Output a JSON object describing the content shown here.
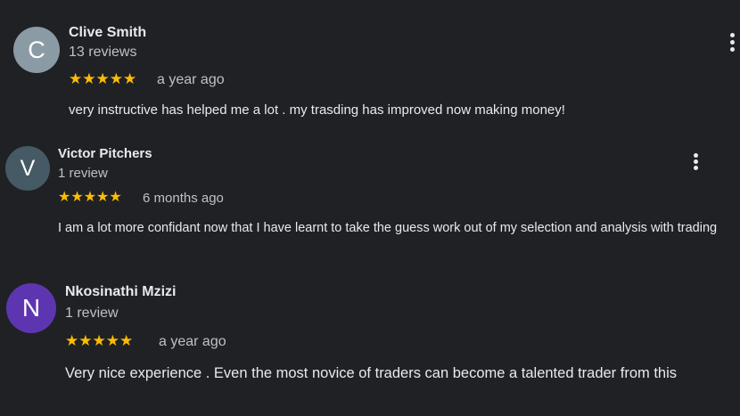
{
  "reviews": [
    {
      "avatar_letter": "C",
      "avatar_color": "#8a9ba6",
      "name": "Clive Smith",
      "reviews_count": "13 reviews",
      "rating": 5,
      "stars": "★★★★★",
      "date": "a year ago",
      "text": "very instructive has helped me a lot . my trasding has improved now making money!",
      "menu_icon": "more-vert-icon"
    },
    {
      "avatar_letter": "V",
      "avatar_color": "#455a64",
      "name": "Victor Pitchers",
      "reviews_count": "1 review",
      "rating": 5,
      "stars": "★★★★★",
      "date": "6 months ago",
      "text": "I am a lot more confidant now that I have learnt to take the guess work out of my selection and analysis with trading",
      "menu_icon": "more-vert-icon"
    },
    {
      "avatar_letter": "N",
      "avatar_color": "#5e35b1",
      "name": "Nkosinathi Mzizi",
      "reviews_count": "1 review",
      "rating": 5,
      "stars": "★★★★★",
      "date": "a year ago",
      "text": "Very nice experience . Even the most novice of traders can become a talented trader from this"
    }
  ],
  "colors": {
    "background": "#202124",
    "star": "#fbbc04",
    "primary_text": "#e8eaed",
    "secondary_text": "#bdc1c6"
  }
}
